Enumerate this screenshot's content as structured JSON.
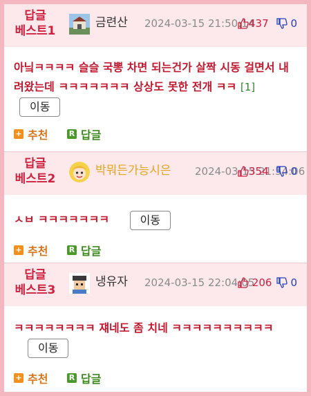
{
  "comments": [
    {
      "badge_line1": "답글",
      "badge_line2": "베스트1",
      "author": "금련산",
      "date": "2024-03-15 21:50:14",
      "upvotes": "437",
      "downvotes": "0",
      "text": "아닠ㅋㅋㅋㅋ 슬슬 국뽕 차면 되는건가 살짝 시동 걸면서 내려왔는데 ㅋㅋㅋㅋㅋㅋㅋ 상상도 못한 전개 ㅋㅋ",
      "reply_count": "[1]",
      "move_label": "이동",
      "recommend_label": "추천",
      "reply_label": "답글"
    },
    {
      "badge_line1": "답글",
      "badge_line2": "베스트2",
      "author": "박뭐든가능시은",
      "date": "2024-03-15 21:54:06",
      "upvotes": "354",
      "downvotes": "0",
      "text": "ㅅㅂ ㅋㅋㅋㅋㅋㅋㅋ",
      "move_label": "이동",
      "recommend_label": "추천",
      "reply_label": "답글"
    },
    {
      "badge_line1": "답글",
      "badge_line2": "베스트3",
      "author": "냉유자",
      "date": "2024-03-15 22:04:05",
      "upvotes": "206",
      "downvotes": "0",
      "text": "ㅋㅋㅋㅋㅋㅋㅋㅋ 쟤네도 좀 치네 ㅋㅋㅋㅋㅋㅋㅋㅋㅋㅋ",
      "move_label": "이동",
      "recommend_label": "추천",
      "reply_label": "답글"
    }
  ],
  "icons": {
    "recommend": "plus-icon",
    "reply": "reply-r-icon",
    "upvote": "thumbs-up-icon",
    "downvote": "thumbs-down-icon"
  },
  "colors": {
    "accent": "#d0203e",
    "frame": "#f4b6bf",
    "header_bg": "#fde9ec",
    "upvote": "#d0203e",
    "downvote": "#1f3fbf"
  }
}
